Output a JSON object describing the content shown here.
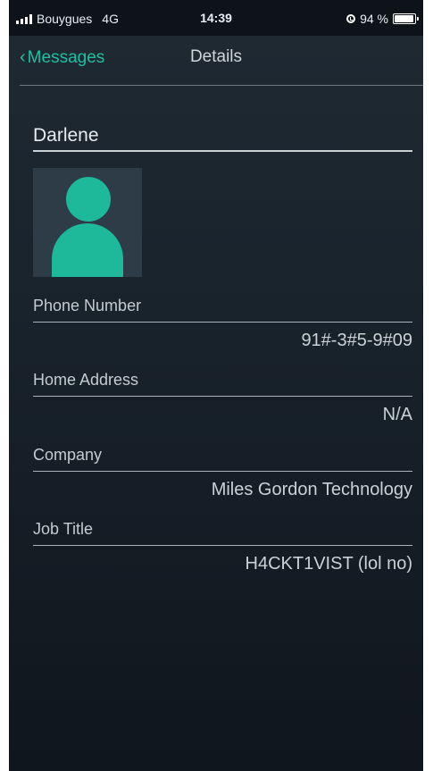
{
  "status_bar": {
    "carrier": "Bouygues",
    "network": "4G",
    "time": "14:39",
    "battery": "94 %",
    "battery_level": 0.94,
    "icons": [
      "signal-icon",
      "orientation-lock-icon",
      "battery-icon"
    ]
  },
  "nav": {
    "back_label": "Messages",
    "back_icon": "chevron-left-icon",
    "title": "Details"
  },
  "contact": {
    "name": "Darlene",
    "avatar_icon": "person-icon",
    "fields": [
      {
        "label": "Phone Number",
        "value": "91#-3#5-9#09"
      },
      {
        "label": "Home Address",
        "value": "N/A"
      },
      {
        "label": "Company",
        "value": "Miles Gordon Technology"
      },
      {
        "label": "Job Title",
        "value": "H4CKT1VIST (lol no)"
      }
    ]
  },
  "colors": {
    "accent": "#1ec0a1",
    "background_top": "#1f2a33",
    "background_bottom": "#0f161d",
    "avatar_bg": "#2e3c48"
  }
}
